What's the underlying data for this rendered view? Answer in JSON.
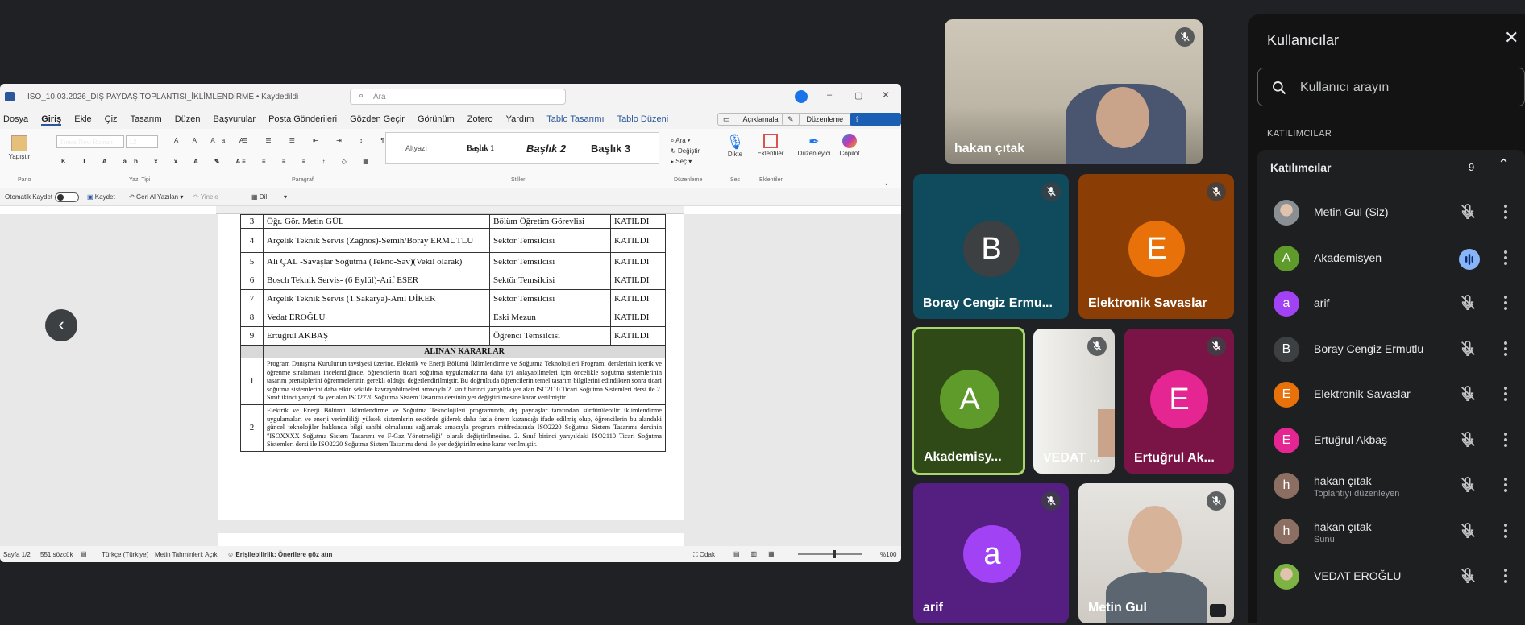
{
  "word": {
    "title": "ISO_10.03.2026_DIŞ PAYDAŞ TOPLANTISI_İKLİMLENDİRME • Kaydedildi",
    "search_placeholder": "Ara",
    "menu": [
      "Dosya",
      "Giriş",
      "Ekle",
      "Çiz",
      "Tasarım",
      "Düzen",
      "Başvurular",
      "Posta Gönderileri",
      "Gözden Geçir",
      "Görünüm",
      "Zotero",
      "Yardım",
      "Tablo Tasarımı",
      "Tablo Düzeni"
    ],
    "comments_label": "Açıklamalar",
    "edit_label": "Düzenleme",
    "share_label": "Paylaş",
    "paste_label": "Yapıştır",
    "font_name": "Times New Roman",
    "font_size": "12",
    "styles": [
      "Altyazı",
      "Başlık 1",
      "Başlık 2",
      "Başlık 3"
    ],
    "find_label": "Ara",
    "replace_label": "Değiştir",
    "select_label": "Seç",
    "dictate_label": "Dikte",
    "addins_label": "Eklentiler",
    "editor_label": "Düzenleyici",
    "copilot_label": "Copilot",
    "groups": [
      "Pano",
      "Yazı Tipi",
      "Paragraf",
      "Stiller",
      "Düzenleme",
      "Ses",
      "Eklentiler"
    ],
    "autosave_label": "Otomatik Kaydet",
    "save_label": "Kaydet",
    "undo_label": "Geri Al Yazılan",
    "redo_label": "Yinele",
    "dil_label": "Dil",
    "status": {
      "page": "Sayfa 1/2",
      "words": "551 sözcük",
      "lang": "Türkçe (Türkiye)",
      "predict": "Metin Tahminleri: Açık",
      "access": "Erişilebilirlik: Önerilere göz atın",
      "focus": "Odak",
      "zoom": "%100"
    },
    "table": {
      "rows": [
        {
          "n": "3",
          "name": "Öğr. Gör. Metin GÜL",
          "role": "Bölüm Öğretim Görevlisi",
          "status": "KATILDI"
        },
        {
          "n": "4",
          "name": "Arçelik Teknik Servis (Zağnos)-Semih/Boray ERMUTLU",
          "role": "Sektör Temsilcisi",
          "status": "KATILDI"
        },
        {
          "n": "5",
          "name": "Ali ÇAL -Savaşlar Soğutma (Tekno-Sav)(Vekil olarak)",
          "role": "Sektör Temsilcisi",
          "status": "KATILDI"
        },
        {
          "n": "6",
          "name": "Bosch Teknik Servis- (6 Eylül)-Arif ESER",
          "role": "Sektör Temsilcisi",
          "status": "KATILDI"
        },
        {
          "n": "7",
          "name": "Arçelik Teknik Servis (1.Sakarya)-Anıl DİKER",
          "role": "Sektör Temsilcisi",
          "status": "KATILDI"
        },
        {
          "n": "8",
          "name": "Vedat EROĞLU",
          "role": "Eski Mezun",
          "status": "KATILDI"
        },
        {
          "n": "9",
          "name": "Ertuğrul AKBAŞ",
          "role": "Öğrenci Temsilcisi",
          "status": "KATILDI"
        }
      ],
      "decisions_header": "ALINAN KARARLAR",
      "decisions": [
        {
          "n": "1",
          "text": "Program Danışma Kurulunun tavsiyesi üzerine, Elektrik ve Enerji Bölümü İklimlendirme ve Soğutma Teknolojileri Programı derslerinin içerik ve öğrenme sıralaması incelendiğinde, öğrencilerin ticari soğutma uygulamalarına daha iyi anlayabilmeleri için öncelikle soğutma sistemlerinin tasarım prensiplerini öğrenmelerinin gerekli olduğu değerlendirilmiştir. Bu doğrultuda öğrencilerin temel tasarım bilgilerini edindikten sonra ticari soğutma sistemlerini daha etkin şekilde kavrayabilmeleri amacıyla 2. sınıf birinci yarıyılda yer alan ISO2110 Ticari Soğutma Sistemleri dersi ile 2. Sınıf ikinci yarıyıl da yer alan ISO2220 Soğutma Sistem Tasarımı dersinin yer değiştirilmesine karar verilmiştir."
        },
        {
          "n": "2",
          "text": "Elektrik ve Enerji Bölümü İklimlendirme ve Soğutma Teknolojileri programında, dış paydaşlar tarafından sürdürülebilir iklimlendirme uygulamaları ve enerji verimliliği yüksek sistemlerin sektörde giderek daha fazla önem kazandığı ifade edilmiş olup, öğrencilerin bu alandaki güncel teknolojiler hakkında bilgi sahibi olmalarını sağlamak amacıyla program müfredatında ISO2220 Soğutma Sistem Tasarımı dersinin \"ISOXXXX Soğutma Sistem Tasarımı ve F-Gaz Yönetmeliği\" olarak değiştirilmesine. 2. Sınıf birinci yarıyıldaki ISO2110 Ticari Soğutma Sistemleri dersi ile ISO2220 Soğutma Sistem Tasarımı dersi ile yer değiştirilmesine karar verilmiştir."
        }
      ]
    }
  },
  "tiles": {
    "hakan": "hakan çıtak",
    "boray": {
      "name": "Boray Cengiz Ermu...",
      "initial": "B",
      "color": "#3c4043"
    },
    "elektronik": {
      "name": "Elektronik Savaslar",
      "initial": "E",
      "color": "#e8710a"
    },
    "akademi": {
      "name": "Akademisy...",
      "initial": "A",
      "color": "#5e9b2a"
    },
    "vedat": "VEDAT ...",
    "ertugrul": {
      "name": "Ertuğrul Ak...",
      "initial": "E",
      "color": "#e52592"
    },
    "arif": {
      "name": "arif",
      "initial": "a",
      "color": "#a142f4"
    },
    "metin": "Metin Gul"
  },
  "panel": {
    "title": "Kullanıcılar",
    "search_placeholder": "Kullanıcı arayın",
    "section": "KATILIMCILAR",
    "group_label": "Katılımcılar",
    "count": "9",
    "people": [
      {
        "name": "Metin Gul (Siz)",
        "sub": "",
        "initial": "",
        "color": "#8a8f94",
        "photo": true
      },
      {
        "name": "Akademisyen",
        "sub": "",
        "initial": "A",
        "color": "#5e9b2a",
        "speaking": true
      },
      {
        "name": "arif",
        "sub": "",
        "initial": "a",
        "color": "#a142f4"
      },
      {
        "name": "Boray Cengiz Ermutlu",
        "sub": "",
        "initial": "B",
        "color": "#3c4043"
      },
      {
        "name": "Elektronik Savaslar",
        "sub": "",
        "initial": "E",
        "color": "#e8710a"
      },
      {
        "name": "Ertuğrul Akbaş",
        "sub": "",
        "initial": "E",
        "color": "#e52592"
      },
      {
        "name": "hakan çıtak",
        "sub": "Toplantıyı düzenleyen",
        "initial": "h",
        "color": "#8d6e63"
      },
      {
        "name": "hakan çıtak",
        "sub": "Sunu",
        "initial": "h",
        "color": "#8d6e63"
      },
      {
        "name": "VEDAT EROĞLU",
        "sub": "",
        "initial": "",
        "color": "#7cb342",
        "photo": true
      }
    ]
  }
}
